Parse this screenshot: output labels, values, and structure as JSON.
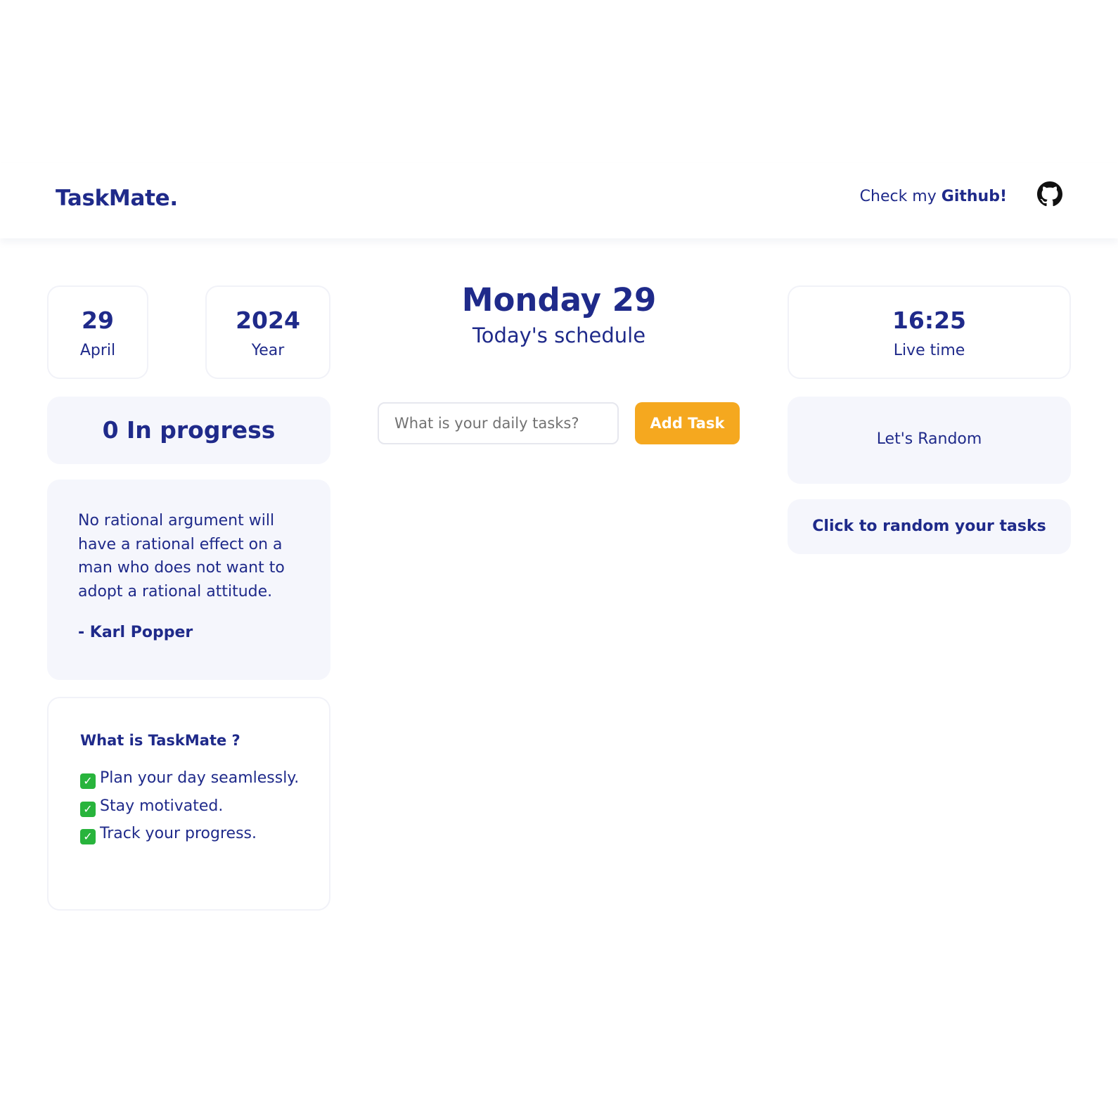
{
  "app": {
    "logo": "TaskMate.",
    "github_prefix": "Check my",
    "github_strong": "Github!",
    "github_icon": "github-icon"
  },
  "stats": {
    "day": {
      "value": "29",
      "label": "April"
    },
    "year": {
      "value": "2024",
      "label": "Year"
    },
    "time": {
      "value": "16:25",
      "label": "Live time"
    },
    "progress": "0 In progress"
  },
  "quote": {
    "text": "No rational argument will have a rational effect on a man who does not want to adopt a rational attitude.",
    "author": "- Karl Popper"
  },
  "about": {
    "title": "What is TaskMate ?",
    "items": [
      "Plan your day seamlessly.",
      "Stay motivated.",
      "Track your progress."
    ],
    "check_icon": "check-mark-icon"
  },
  "schedule": {
    "day_title": "Monday 29",
    "subtitle": "Today's schedule",
    "input_placeholder": "What is your daily tasks?",
    "input_value": "",
    "add_button": "Add Task"
  },
  "random": {
    "result": "Let's Random",
    "button": "Click to random your tasks"
  },
  "colors": {
    "primary": "#1f2a8a",
    "accent": "#f5a81f",
    "card_soft": "#f5f6fc",
    "card_border": "#f1f2f8"
  }
}
